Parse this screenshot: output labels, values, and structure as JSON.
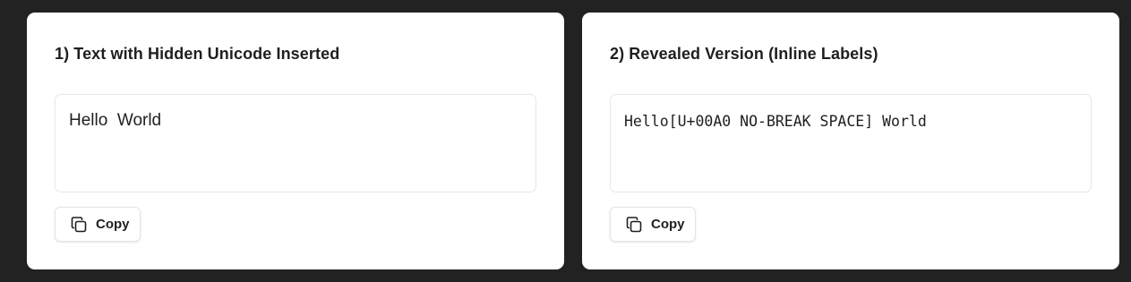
{
  "panels": [
    {
      "title": "1) Text with Hidden Unicode Inserted",
      "text": "Hello  World",
      "copy_label": "Copy",
      "copy_icon": "copy-icon"
    },
    {
      "title": "2) Revealed Version (Inline Labels)",
      "text": "Hello[U+00A0 NO-BREAK SPACE] World",
      "copy_label": "Copy",
      "copy_icon": "copy-icon"
    }
  ],
  "colors": {
    "background": "#222222",
    "panel": "#ffffff",
    "text": "#1f1f1f",
    "border": "#e5e7eb"
  }
}
